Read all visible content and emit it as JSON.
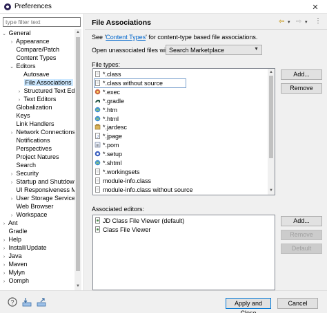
{
  "window": {
    "title": "Preferences",
    "close_glyph": "✕"
  },
  "filter": {
    "placeholder": "type filter text"
  },
  "tree": {
    "rows": [
      {
        "label": "General",
        "toggle": "⌄",
        "indent": 0
      },
      {
        "label": "Appearance",
        "toggle": "›",
        "indent": 1
      },
      {
        "label": "Compare/Patch",
        "toggle": "",
        "indent": 1
      },
      {
        "label": "Content Types",
        "toggle": "",
        "indent": 1
      },
      {
        "label": "Editors",
        "toggle": "⌄",
        "indent": 1
      },
      {
        "label": "Autosave",
        "toggle": "",
        "indent": 2
      },
      {
        "label": "File Associations",
        "toggle": "",
        "indent": 2,
        "selected": true
      },
      {
        "label": "Structured Text Ed",
        "toggle": "›",
        "indent": 2
      },
      {
        "label": "Text Editors",
        "toggle": "›",
        "indent": 2
      },
      {
        "label": "Globalization",
        "toggle": "",
        "indent": 1
      },
      {
        "label": "Keys",
        "toggle": "",
        "indent": 1
      },
      {
        "label": "Link Handlers",
        "toggle": "",
        "indent": 1
      },
      {
        "label": "Network Connections",
        "toggle": "›",
        "indent": 1
      },
      {
        "label": "Notifications",
        "toggle": "",
        "indent": 1
      },
      {
        "label": "Perspectives",
        "toggle": "",
        "indent": 1
      },
      {
        "label": "Project Natures",
        "toggle": "",
        "indent": 1
      },
      {
        "label": "Search",
        "toggle": "",
        "indent": 1
      },
      {
        "label": "Security",
        "toggle": "›",
        "indent": 1
      },
      {
        "label": "Startup and Shutdown",
        "toggle": "›",
        "indent": 1
      },
      {
        "label": "UI Responsiveness Monitoring",
        "toggle": "",
        "indent": 1
      },
      {
        "label": "User Storage Service",
        "toggle": "›",
        "indent": 1
      },
      {
        "label": "Web Browser",
        "toggle": "",
        "indent": 1
      },
      {
        "label": "Workspace",
        "toggle": "›",
        "indent": 1
      },
      {
        "label": "Ant",
        "toggle": "›",
        "indent": 0
      },
      {
        "label": "Gradle",
        "toggle": "",
        "indent": 0
      },
      {
        "label": "Help",
        "toggle": "›",
        "indent": 0
      },
      {
        "label": "Install/Update",
        "toggle": "›",
        "indent": 0
      },
      {
        "label": "Java",
        "toggle": "›",
        "indent": 0
      },
      {
        "label": "Maven",
        "toggle": "›",
        "indent": 0
      },
      {
        "label": "Mylyn",
        "toggle": "›",
        "indent": 0
      },
      {
        "label": "Oomph",
        "toggle": "›",
        "indent": 0
      }
    ]
  },
  "page": {
    "title": "File Associations",
    "see_prefix": "See '",
    "see_link": "Content Types",
    "see_suffix": "' for content-type based file associations.",
    "open_label": "Open unassociated files with:",
    "open_value": "Search Marketplace",
    "file_types_label": "File types:",
    "assoc_label": "Associated editors:"
  },
  "file_types": [
    {
      "label": "*.class",
      "icon": "file-icon"
    },
    {
      "label": "*.class without source",
      "icon": "file-icon",
      "selected": true
    },
    {
      "label": "*.exec",
      "icon": "coverage-icon"
    },
    {
      "label": "*.gradle",
      "icon": "gradle-icon"
    },
    {
      "label": "*.htm",
      "icon": "globe-icon"
    },
    {
      "label": "*.html",
      "icon": "globe-icon"
    },
    {
      "label": "*.jardesc",
      "icon": "jar-icon"
    },
    {
      "label": "*.jpage",
      "icon": "jpage-icon"
    },
    {
      "label": "*.pom",
      "icon": "pom-icon"
    },
    {
      "label": "*.setup",
      "icon": "setup-icon"
    },
    {
      "label": "*.shtml",
      "icon": "globe-icon"
    },
    {
      "label": "*.workingsets",
      "icon": "file-icon"
    },
    {
      "label": "module-info.class",
      "icon": "file-icon"
    },
    {
      "label": "module-info.class without source",
      "icon": "file-icon"
    }
  ],
  "editors": [
    {
      "label": "JD Class File Viewer (default)",
      "icon": "class-viewer-icon"
    },
    {
      "label": "Class File Viewer",
      "icon": "class-viewer-icon"
    }
  ],
  "buttons": {
    "add_types": "Add...",
    "remove_types": "Remove",
    "add_editors": "Add...",
    "remove_editors": "Remove",
    "default": "Default",
    "apply_close": "Apply and Close",
    "cancel": "Cancel"
  },
  "colors": {
    "selection": "#cce8ff",
    "link": "#0066cc",
    "nav_arrow": "#c38f00"
  }
}
